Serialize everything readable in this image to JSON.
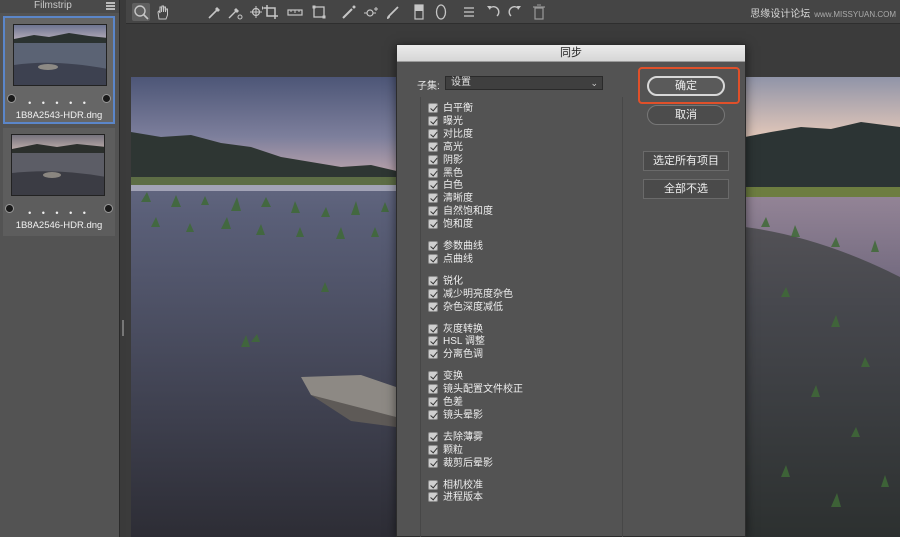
{
  "filmstrip": {
    "title": "Filmstrip",
    "items": [
      {
        "filename": "1B8A2543-HDR.dng",
        "rating_dots": "• • • • •",
        "selected": true
      },
      {
        "filename": "1B8A2546-HDR.dng",
        "rating_dots": "• • • • •",
        "selected": false
      }
    ]
  },
  "toolbar": {
    "tools": [
      "zoom-icon",
      "hand-icon",
      "white-balance-icon",
      "color-sampler-icon",
      "targeted-adjustment-icon",
      "crop-icon",
      "straighten-icon",
      "transform-icon",
      "spot-removal-icon",
      "red-eye-icon",
      "adjustment-brush-icon",
      "graduated-filter-icon",
      "radial-filter-icon",
      "rotate-left-icon",
      "rotate-right-icon",
      "trash-icon"
    ],
    "watermark": "思缘设计论坛",
    "watermark_url": "www.MISSYUAN.COM"
  },
  "dialog": {
    "title": "同步",
    "subset_label": "子集:",
    "subset_value": "设置",
    "ok_label": "确定",
    "cancel_label": "取消",
    "select_all_label": "选定所有项目",
    "select_none_label": "全部不选",
    "groups": [
      [
        "白平衡",
        "曝光",
        "对比度",
        "高光",
        "阴影",
        "黑色",
        "白色",
        "清晰度",
        "自然饱和度",
        "饱和度"
      ],
      [
        "参数曲线",
        "点曲线"
      ],
      [
        "锐化",
        "减少明亮度杂色",
        "杂色深度减低"
      ],
      [
        "灰度转换",
        "HSL 调整",
        "分离色调"
      ],
      [
        "变换",
        "镜头配置文件校正",
        "色差",
        "镜头晕影"
      ],
      [
        "去除薄雾",
        "颗粒",
        "裁剪后晕影"
      ],
      [
        "相机校准",
        "进程版本"
      ]
    ]
  },
  "colors": {
    "accent_highlight": "#e0502a",
    "selection_border": "#5b86c9"
  }
}
